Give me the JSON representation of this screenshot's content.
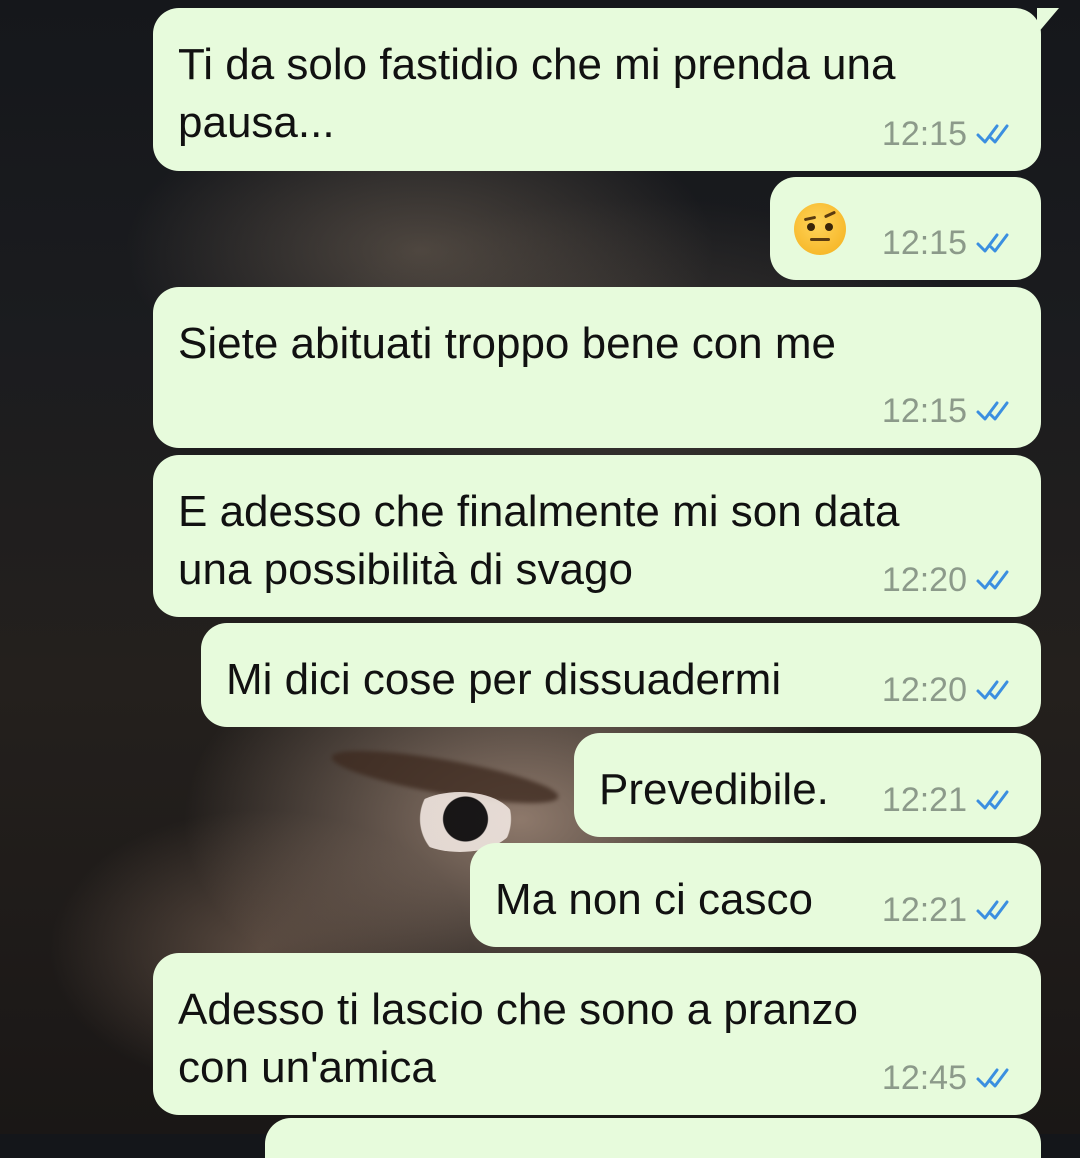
{
  "colors": {
    "outgoing_bubble": "#e7fbdc",
    "timestamp": "#8c9a8a",
    "read_ticks": "#3b8fe0"
  },
  "messages": [
    {
      "text": "Ti da solo fastidio che mi prenda una\npausa...",
      "time": "12:15",
      "status_icon": "double-check-read-icon"
    },
    {
      "emoji_icon": "face-with-raised-eyebrow-emoji",
      "time": "12:15",
      "status_icon": "double-check-read-icon"
    },
    {
      "text": "Siete abituati troppo bene con me",
      "time": "12:15",
      "status_icon": "double-check-read-icon"
    },
    {
      "text": "E adesso che finalmente mi son data\nuna possibilità di svago",
      "time": "12:20",
      "status_icon": "double-check-read-icon"
    },
    {
      "text": "Mi dici cose per dissuadermi",
      "time": "12:20",
      "status_icon": "double-check-read-icon"
    },
    {
      "text": "Prevedibile.",
      "time": "12:21",
      "status_icon": "double-check-read-icon"
    },
    {
      "text": "Ma non ci casco",
      "time": "12:21",
      "status_icon": "double-check-read-icon"
    },
    {
      "text": "Adesso ti lascio che sono a pranzo\ncon un'amica",
      "time": "12:45",
      "status_icon": "double-check-read-icon"
    }
  ]
}
